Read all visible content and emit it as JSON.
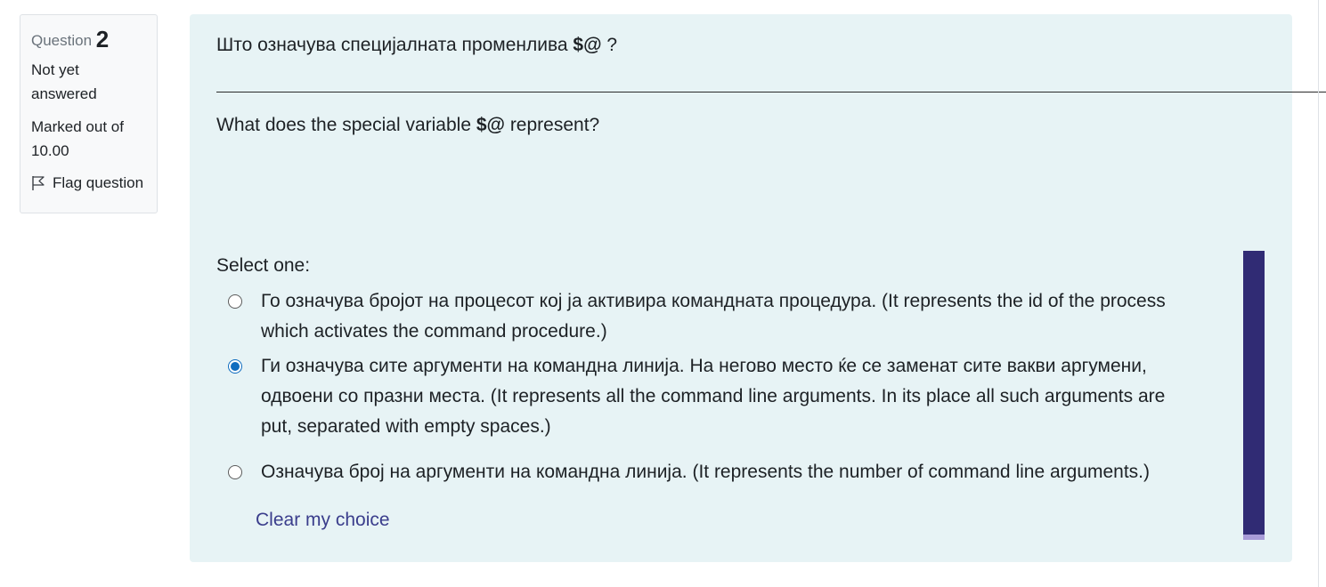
{
  "info": {
    "question_prefix": "Question",
    "question_number": "2",
    "state_line1": "Not yet",
    "state_line2": "answered",
    "grade_line1": "Marked out of",
    "grade_line2": "10.00",
    "flag_label": "Flag question"
  },
  "question": {
    "text_mk_before": "Што означува специјалната променлива ",
    "text_mk_var": "$@",
    "text_mk_after": " ?",
    "divider": "________________________________________________________________________________________________________________________",
    "text_en_before": "What does the special variable ",
    "text_en_var": "$@",
    "text_en_after": " represent?"
  },
  "answers": {
    "prompt": "Select one:",
    "options": [
      {
        "line1": "Го означува бројот на процесот кој ја активира командната процедура. (It represents the id of the process",
        "line2": "which activates the command procedure.)",
        "checked": false
      },
      {
        "line1": "Ги означува сите аргументи на командна линија. На негово место ќе се заменат сите вакви аргумени,",
        "line2": "одвоени со празни места. (It represents all the command line arguments. In its place all such arguments are",
        "line3": "put, separated with empty spaces.)",
        "checked": true
      },
      {
        "line1": "Означува број на аргументи на командна линија. (It represents the number of command line arguments.)",
        "checked": false
      }
    ],
    "clear_label": "Clear my choice"
  },
  "colors": {
    "panel_bg": "#e7f3f5",
    "radio_checked": "#0f6cbf",
    "link": "#3a3d8c",
    "scrollbar": "#302b74"
  }
}
